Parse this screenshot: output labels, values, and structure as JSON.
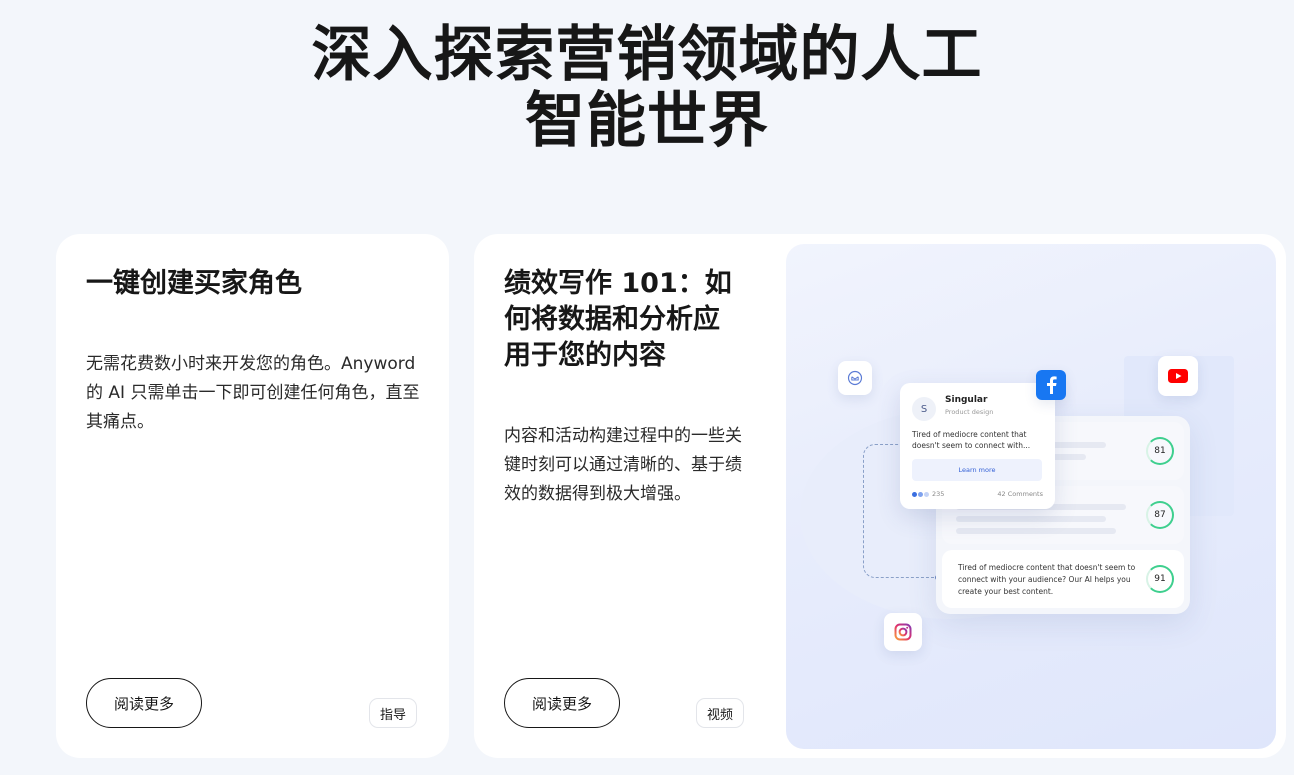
{
  "hero": {
    "title_line1": "深入探索营销领域的人工",
    "title_line2": "智能世界"
  },
  "cards": [
    {
      "title": "一键创建买家角色",
      "description": "无需花费数小时来开发您的角色。Anyword 的 AI 只需单击一下即可创建任何角色，直至其痛点。",
      "button_label": "阅读更多",
      "tag": "指导"
    },
    {
      "title": "绩效写作 101：如何将数据和分析应用于您的内容",
      "description": "内容和活动构建过程中的一些关键时刻可以通过清晰的、基于绩效的数据得到极大增强。",
      "button_label": "阅读更多",
      "tag": "视频"
    }
  ],
  "illustration": {
    "post": {
      "avatar_letter": "S",
      "name": "Singular",
      "subtitle": "Product design",
      "text": "Tired of mediocre content that doesn't seem to connect with...",
      "button": "Learn more",
      "likes": "235",
      "comments": "42 Comments"
    },
    "scores": [
      "81",
      "87",
      "91"
    ],
    "bottom_text": "Tired of mediocre content that doesn't seem to connect with your audience? Our AI helps you create your best content.",
    "colors": {
      "facebook": "#1877f2",
      "youtube": "#ff0000",
      "score_ring": "#3ecf8e"
    },
    "icons": [
      "mail-icon",
      "facebook-icon",
      "youtube-icon",
      "instagram-icon"
    ]
  }
}
